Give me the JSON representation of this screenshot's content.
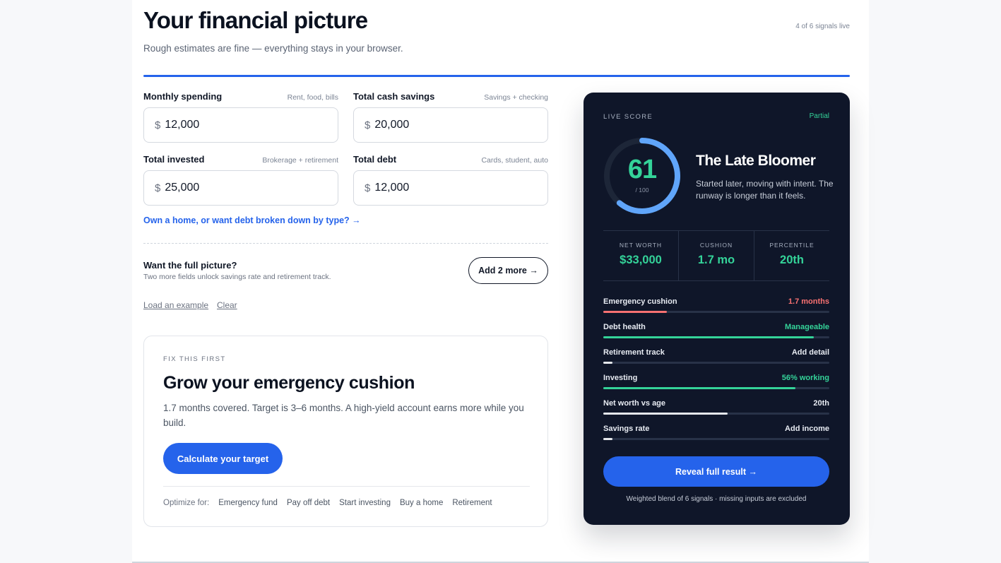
{
  "header": {
    "title": "Your financial picture",
    "subtitle": "Rough estimates are fine — everything stays in your browser.",
    "signals_status": "4 of 6 signals live"
  },
  "fields": [
    {
      "label": "Monthly spending",
      "hint": "Rent, food, bills",
      "currency": "$",
      "value": "12,000"
    },
    {
      "label": "Total cash savings",
      "hint": "Savings + checking",
      "currency": "$",
      "value": "20,000"
    },
    {
      "label": "Total invested",
      "hint": "Brokerage + retirement",
      "currency": "$",
      "value": "25,000"
    },
    {
      "label": "Total debt",
      "hint": "Cards, student, auto",
      "currency": "$",
      "value": "12,000"
    }
  ],
  "home_link": "Own a home, or want debt broken down by type? →",
  "full_picture": {
    "title": "Want the full picture?",
    "subtitle": "Two more fields unlock savings rate and retirement track.",
    "button": "Add 2 more →"
  },
  "links": {
    "load_example": "Load an example",
    "clear": "Clear"
  },
  "fix_card": {
    "kicker": "FIX THIS FIRST",
    "title": "Grow your emergency cushion",
    "body": "1.7 months covered. Target is 3–6 months. A high-yield account earns more while you build.",
    "button": "Calculate your target",
    "optimize_label": "Optimize for:",
    "options": [
      "Emergency fund",
      "Pay off debt",
      "Start investing",
      "Buy a home",
      "Retirement"
    ]
  },
  "score_card": {
    "label": "LIVE SCORE",
    "status": "Partial",
    "score": "61",
    "score_max": "/ 100",
    "score_fraction": 0.61,
    "persona": "The Late Bloomer",
    "description": "Started later, moving with intent. The runway is longer than it feels.",
    "stats": [
      {
        "label": "NET WORTH",
        "value": "$33,000"
      },
      {
        "label": "CUSHION",
        "value": "1.7 mo"
      },
      {
        "label": "PERCENTILE",
        "value": "20th"
      }
    ],
    "metrics": [
      {
        "name": "Emergency cushion",
        "value": "1.7 months",
        "level": 0.28,
        "color": "#f87171"
      },
      {
        "name": "Debt health",
        "value": "Manageable",
        "level": 0.93,
        "color": "#34d399"
      },
      {
        "name": "Retirement track",
        "value": "Add detail",
        "level": 0.04,
        "color": "#e5e7eb"
      },
      {
        "name": "Investing",
        "value": "56% working",
        "level": 0.85,
        "color": "#34d399"
      },
      {
        "name": "Net worth vs age",
        "value": "20th",
        "level": 0.55,
        "color": "#e5e7eb"
      },
      {
        "name": "Savings rate",
        "value": "Add income",
        "level": 0.04,
        "color": "#e5e7eb"
      }
    ],
    "reveal_button": "Reveal full result →",
    "footnote": "Weighted blend of 6 signals · missing inputs are excluded"
  },
  "colors": {
    "accent": "#2563eb",
    "positive": "#34d399",
    "warning": "#f87171",
    "card_bg": "#0f1629",
    "ring": "#60a5fa"
  }
}
